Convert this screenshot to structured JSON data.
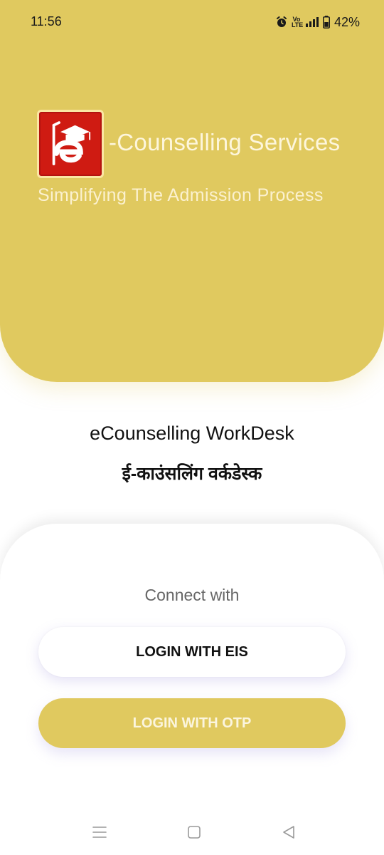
{
  "status_bar": {
    "time": "11:56",
    "volte": "Vo LTE",
    "battery": "42%",
    "icons": [
      "alarm-icon",
      "volte-icon",
      "signal-icon",
      "battery-icon"
    ]
  },
  "header": {
    "logo_letter": "e",
    "brand_name": "-Counselling Services",
    "tagline": "Simplifying The Admission Process",
    "colors": {
      "header_bg": "#e0c95f",
      "logo_red": "#cf1b12"
    }
  },
  "app": {
    "title": "eCounselling WorkDesk",
    "title_hindi": "ई-काउंसलिंग वर्कडेस्क"
  },
  "login": {
    "connect_label": "Connect with",
    "eis_button": "LOGIN WITH EIS",
    "otp_button": "LOGIN WITH OTP"
  },
  "nav": {
    "icons": [
      "menu-icon",
      "home-icon",
      "back-icon"
    ]
  }
}
